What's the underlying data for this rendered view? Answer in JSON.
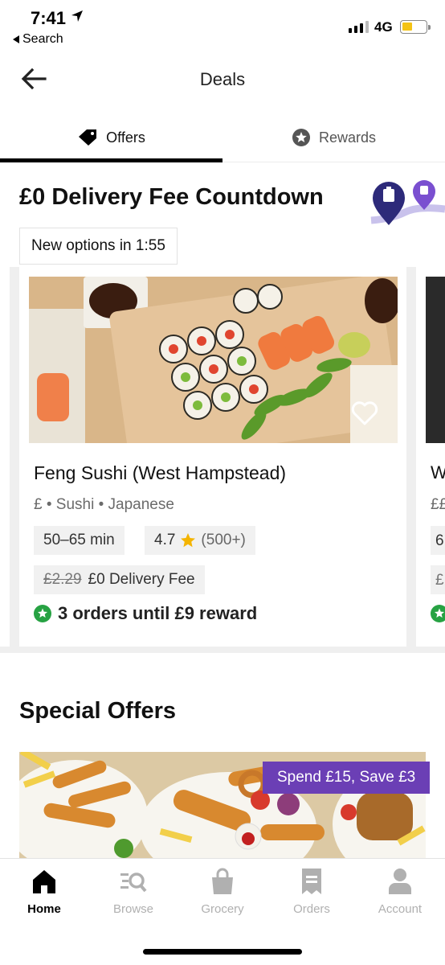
{
  "status_bar": {
    "time": "7:41",
    "back_app": "Search",
    "network": "4G",
    "icons": [
      "location-arrow-icon",
      "signal-icon",
      "battery-icon"
    ]
  },
  "header": {
    "title": "Deals",
    "back_icon": "arrow-left-icon"
  },
  "tabs": [
    {
      "label": "Offers",
      "icon": "tag-icon",
      "active": true
    },
    {
      "label": "Rewards",
      "icon": "star-badge-icon",
      "active": false
    }
  ],
  "countdown": {
    "title": "£0 Delivery Fee Countdown",
    "timer_text": "New options in 1:55"
  },
  "featured_card": {
    "name": "Feng Sushi (West Hampstead)",
    "price_level": "£",
    "categories": [
      "Sushi",
      "Japanese"
    ],
    "meta": "£ • Sushi • Japanese",
    "time": "50–65 min",
    "rating": "4.7",
    "rating_count": "(500+)",
    "old_fee": "£2.29",
    "new_fee": "£0 Delivery Fee",
    "reward_text": "3 orders until £9 reward"
  },
  "next_card": {
    "name_fragment": "W",
    "meta_fragment": "££",
    "time_fragment": "6",
    "fee_fragment": "£"
  },
  "special_offers": {
    "title": "Special Offers",
    "tag": "Spend £15, Save £3"
  },
  "bottom_nav": [
    {
      "label": "Home",
      "icon": "home-icon",
      "active": true
    },
    {
      "label": "Browse",
      "icon": "browse-search-icon",
      "active": false
    },
    {
      "label": "Grocery",
      "icon": "shopping-bag-icon",
      "active": false
    },
    {
      "label": "Orders",
      "icon": "receipt-icon",
      "active": false
    },
    {
      "label": "Account",
      "icon": "person-icon",
      "active": false
    }
  ],
  "colors": {
    "accent_purple": "#6b3fb5",
    "route_navy": "#3a3a8c",
    "reward_green": "#27a243",
    "star_gold": "#f4b400"
  }
}
